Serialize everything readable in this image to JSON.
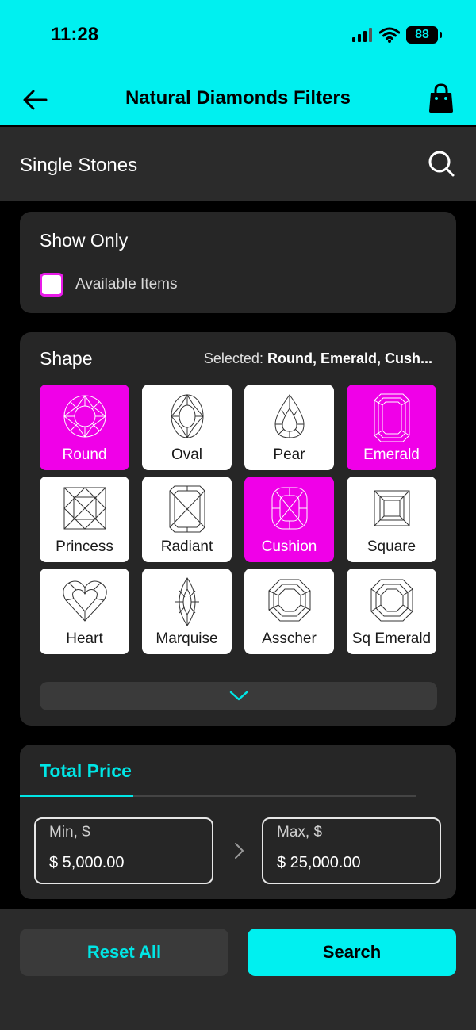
{
  "status_bar": {
    "time": "11:28",
    "battery": "88"
  },
  "header": {
    "title": "Natural Diamonds Filters"
  },
  "section": {
    "title": "Single Stones"
  },
  "show_only": {
    "title": "Show Only",
    "checkbox_label": "Available Items",
    "checked": false
  },
  "shape": {
    "title": "Shape",
    "selected_prefix": "Selected:",
    "selected_value": "Round, Emerald, Cush...",
    "items": [
      {
        "label": "Round",
        "selected": true,
        "icon": "round-diamond-icon"
      },
      {
        "label": "Oval",
        "selected": false,
        "icon": "oval-diamond-icon"
      },
      {
        "label": "Pear",
        "selected": false,
        "icon": "pear-diamond-icon"
      },
      {
        "label": "Emerald",
        "selected": true,
        "icon": "emerald-diamond-icon"
      },
      {
        "label": "Princess",
        "selected": false,
        "icon": "princess-diamond-icon"
      },
      {
        "label": "Radiant",
        "selected": false,
        "icon": "radiant-diamond-icon"
      },
      {
        "label": "Cushion",
        "selected": true,
        "icon": "cushion-diamond-icon"
      },
      {
        "label": "Square",
        "selected": false,
        "icon": "square-diamond-icon"
      },
      {
        "label": "Heart",
        "selected": false,
        "icon": "heart-diamond-icon"
      },
      {
        "label": "Marquise",
        "selected": false,
        "icon": "marquise-diamond-icon"
      },
      {
        "label": "Asscher",
        "selected": false,
        "icon": "asscher-diamond-icon"
      },
      {
        "label": "Sq Emerald",
        "selected": false,
        "icon": "sq-emerald-diamond-icon"
      }
    ]
  },
  "price": {
    "tab_label": "Total Price",
    "min_label": "Min, $",
    "min_value": "$ 5,000.00",
    "max_label": "Max, $",
    "max_value": "$ 25,000.00"
  },
  "footer": {
    "reset_label": "Reset All",
    "search_label": "Search"
  },
  "colors": {
    "accent_cyan": "#00F0F0",
    "selected_magenta": "#F000E8",
    "card_bg": "#262626"
  }
}
